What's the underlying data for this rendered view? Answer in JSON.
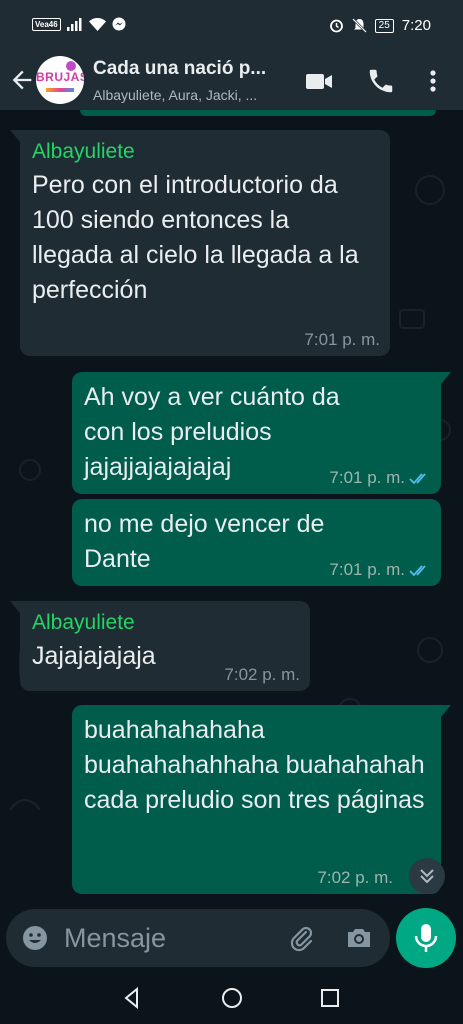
{
  "status_bar": {
    "carrier": "Vea46",
    "time": "7:20",
    "battery": "25",
    "icons": [
      "signal-icon",
      "wifi-icon",
      "messenger-icon",
      "alarm-icon",
      "mute-icon",
      "battery-icon"
    ]
  },
  "header": {
    "avatar_text": "BRUJAS",
    "title": "Cada una nació p...",
    "members": "Albayuliete, Aura, Jacki, ...",
    "icons": [
      "back-arrow-icon",
      "video-call-icon",
      "phone-call-icon",
      "more-vert-icon"
    ]
  },
  "messages": [
    {
      "direction": "in",
      "sender": "Albayuliete",
      "text": "Pero con el introductorio da 100 siendo entonces la llegada al cielo la llegada a la perfección",
      "time": "7:01 p. m."
    },
    {
      "direction": "out",
      "text": "Ah voy a ver cuánto da con los preludios jajajjajajajajaj",
      "time": "7:01 p. m.",
      "read": true
    },
    {
      "direction": "out",
      "text": "no me dejo vencer de Dante",
      "time": "7:01 p. m.",
      "read": true
    },
    {
      "direction": "in",
      "sender": "Albayuliete",
      "text": "Jajajajajaja",
      "time": "7:02 p. m."
    },
    {
      "direction": "out",
      "text": "buahahahahaha buahahahahhaha buahahahah cada preludio son tres páginas",
      "time": "7:02 p. m."
    }
  ],
  "input": {
    "placeholder": "Mensaje",
    "icons": [
      "emoji-icon",
      "attach-icon",
      "camera-icon",
      "mic-icon"
    ]
  },
  "colors": {
    "background": "#0b141a",
    "bar": "#1f2c34",
    "incoming_bubble": "#202c33",
    "outgoing_bubble": "#005c4b",
    "sender_name": "#25d366",
    "accent": "#00a884",
    "read_ticks": "#53bdeb"
  }
}
